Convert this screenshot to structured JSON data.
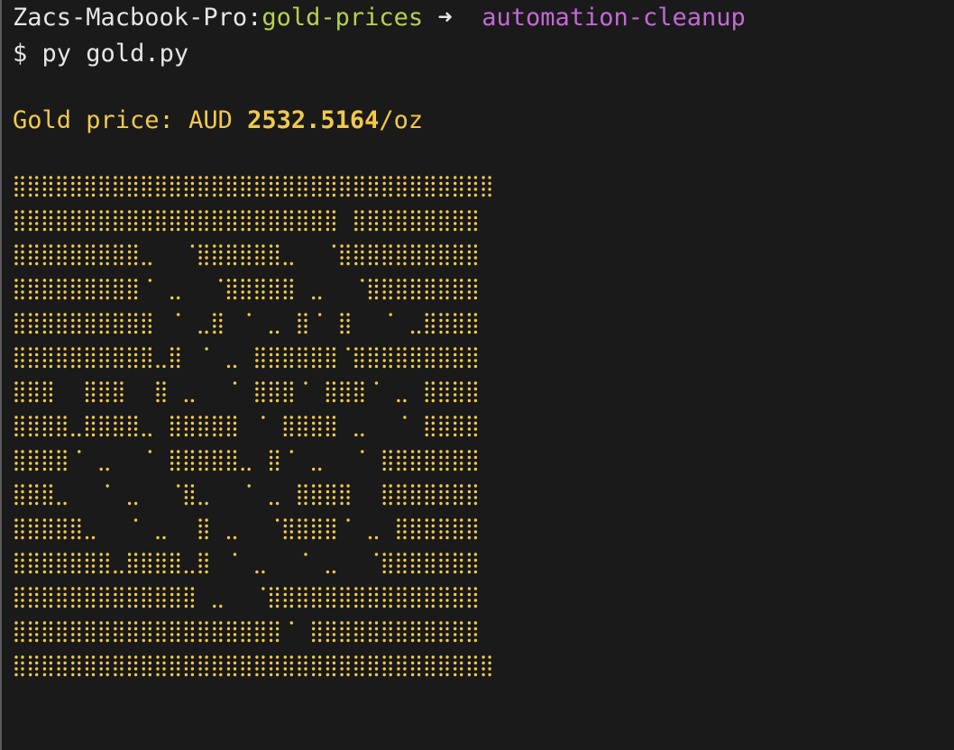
{
  "prompt": {
    "host": "Zacs-Macbook-Pro",
    "separator": ":",
    "directory": "gold-prices",
    "arrow": "➜",
    "branch": "automation-cleanup"
  },
  "command": {
    "symbol": "$",
    "text": "py gold.py"
  },
  "output": {
    "label": "Gold price: AUD ",
    "value": "2532.5164",
    "unit": "/oz"
  },
  "colors": {
    "background": "#1a1a1a",
    "text": "#e6e6e6",
    "directory": "#b5d24f",
    "branch": "#c469d6",
    "gold": "#f2c94c"
  },
  "ascii_art": {
    "description_icon": "gold-bars-braille-art",
    "rows": [
      "##################################",
      "#######################.#########",
      "#########....######....##########",
      "#########......#####.....########",
      "##########....#.....#..#.....####",
      "##########.#.....######.#########",
      "###..###..#......###..###....####",
      "####.####..#####...####......####",
      "####.......#####..#.......#######",
      "###.........#.......####..#######",
      "#####........#.....####....######",
      "#######.####.#............#######",
      "#############.....###############",
      "###################..############",
      "##################################"
    ]
  }
}
